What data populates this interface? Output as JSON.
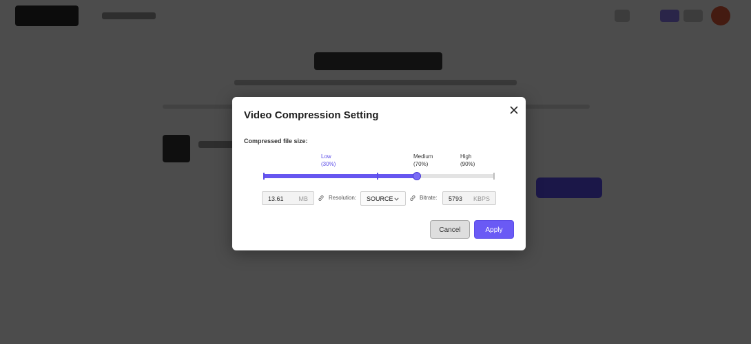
{
  "modal": {
    "title": "Video Compression Setting",
    "section_label": "Compressed file size:",
    "slider": {
      "marks": [
        {
          "label": "Low",
          "sub": "(30%)",
          "active": true
        },
        {
          "label": "Medium",
          "sub": "(70%)",
          "active": false
        },
        {
          "label": "High",
          "sub": "(90%)",
          "active": false
        }
      ],
      "value": 0.665
    },
    "size": {
      "value": "13.61",
      "unit": "MB"
    },
    "resolution": {
      "label": "Resolution:",
      "value": "SOURCE"
    },
    "bitrate": {
      "label": "Bitrate:",
      "value": "5793",
      "unit": "KBPS"
    },
    "buttons": {
      "cancel": "Cancel",
      "apply": "Apply"
    }
  },
  "colors": {
    "accent": "#6a5af5",
    "overlay": "rgba(0,0,0,0.70)"
  }
}
